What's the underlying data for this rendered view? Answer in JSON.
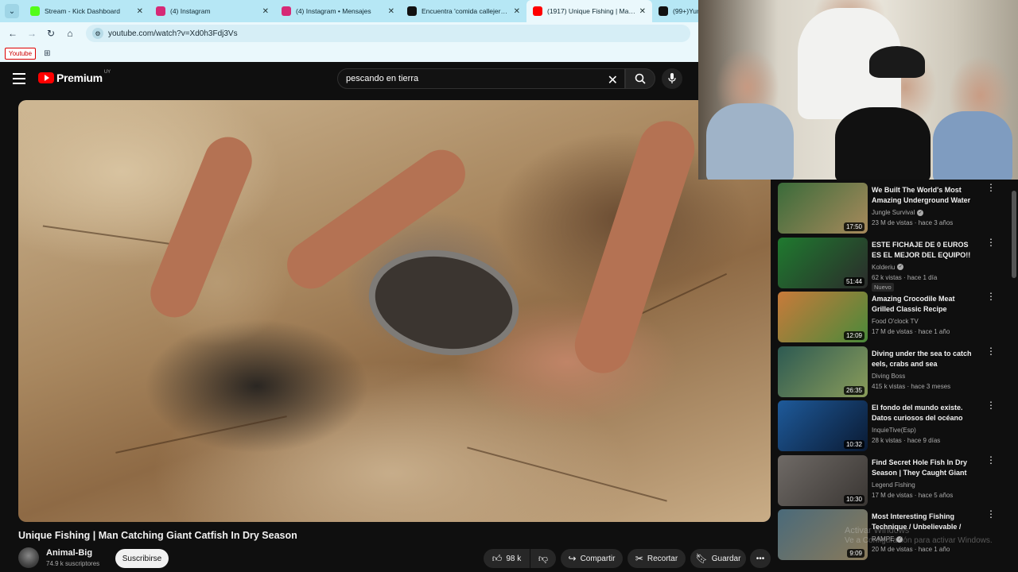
{
  "browser": {
    "tabs": [
      {
        "title": "Stream - Kick Dashboard",
        "favicon_color": "#53fc18",
        "active": false
      },
      {
        "title": "(4) Instagram",
        "favicon_color": "#d62976",
        "active": false
      },
      {
        "title": "(4) Instagram • Mensajes",
        "favicon_color": "#d62976",
        "active": false
      },
      {
        "title": "Encuentra 'comida callejera ind...",
        "favicon_color": "#111111",
        "active": false
      },
      {
        "title": "(1917) Unique Fishing | Man Ca...",
        "favicon_color": "#ff0000",
        "active": true
      },
      {
        "title": "(99+)Yumm...",
        "favicon_color": "#111111",
        "active": false
      }
    ],
    "url": "youtube.com/watch?v=Xd0h3Fdj3Vs",
    "bookmark_label": "Youtube"
  },
  "header": {
    "logo_text": "Premium",
    "country_code": "UY",
    "search_query": "pescando en tierra"
  },
  "video": {
    "title": "Unique Fishing | Man Catching Giant Catfish In Dry Season",
    "channel": "Animal-Big",
    "subscribers": "74.9 k suscriptores",
    "subscribe_label": "Suscribirse",
    "likes": "98 k",
    "share_label": "Compartir",
    "clip_label": "Recortar",
    "save_label": "Guardar"
  },
  "recommendations": [
    {
      "title": "We Built The World's Most Amazing Underground Water ...",
      "channel": "Jungle Survival",
      "verified": true,
      "meta": "23 M de vistas · hace 3 años",
      "duration": "17:50",
      "badge": "",
      "thumb_colors": [
        "#3a6b3a",
        "#a88a5c"
      ]
    },
    {
      "title": "ESTE FICHAJE DE 0 EUROS ES EL MEJOR DEL EQUIPO!! ...",
      "channel": "Kolderiu",
      "verified": true,
      "meta": "62 k vistas · hace 1 día",
      "duration": "51:44",
      "badge": "Nuevo",
      "thumb_colors": [
        "#1f7a2f",
        "#2b2b2b"
      ]
    },
    {
      "title": "Amazing Crocodile Meat Grilled Classic Recipe Ingredients ...",
      "channel": "Food O'clock TV",
      "verified": false,
      "meta": "17 M de vistas · hace 1 año",
      "duration": "12:09",
      "badge": "",
      "thumb_colors": [
        "#c87a3a",
        "#4a8a3a"
      ]
    },
    {
      "title": "Diving under the sea to catch eels, crabs and sea cucumber...",
      "channel": "Diving Boss",
      "verified": false,
      "meta": "415 k vistas · hace 3 meses",
      "duration": "26:35",
      "badge": "",
      "thumb_colors": [
        "#2d5a52",
        "#8a9c5a"
      ]
    },
    {
      "title": "El fondo del mundo existe. Datos curiosos del océano 😯...",
      "channel": "InquieTive(Esp)",
      "verified": false,
      "meta": "28 k vistas · hace 9 días",
      "duration": "10:32",
      "badge": "",
      "thumb_colors": [
        "#1e5a9a",
        "#0a1a33"
      ]
    },
    {
      "title": "Find Secret Hole Fish In Dry Season | They Caught Giant Fi...",
      "channel": "Legend Fishing",
      "verified": false,
      "meta": "17 M de vistas · hace 5 años",
      "duration": "10:30",
      "badge": "",
      "thumb_colors": [
        "#6f6a66",
        "#3a3633"
      ]
    },
    {
      "title": "Most Interesting Fishing Technique / Unbelievable / Big...",
      "channel": "RAMPE",
      "verified": true,
      "meta": "20 M de vistas · hace 1 año",
      "duration": "9:09",
      "badge": "",
      "thumb_colors": [
        "#4a6a7a",
        "#8a7a5a"
      ]
    }
  ],
  "watermark": {
    "line1": "Activar Windows",
    "line2": "Ve a Configuración para activar Windows."
  }
}
